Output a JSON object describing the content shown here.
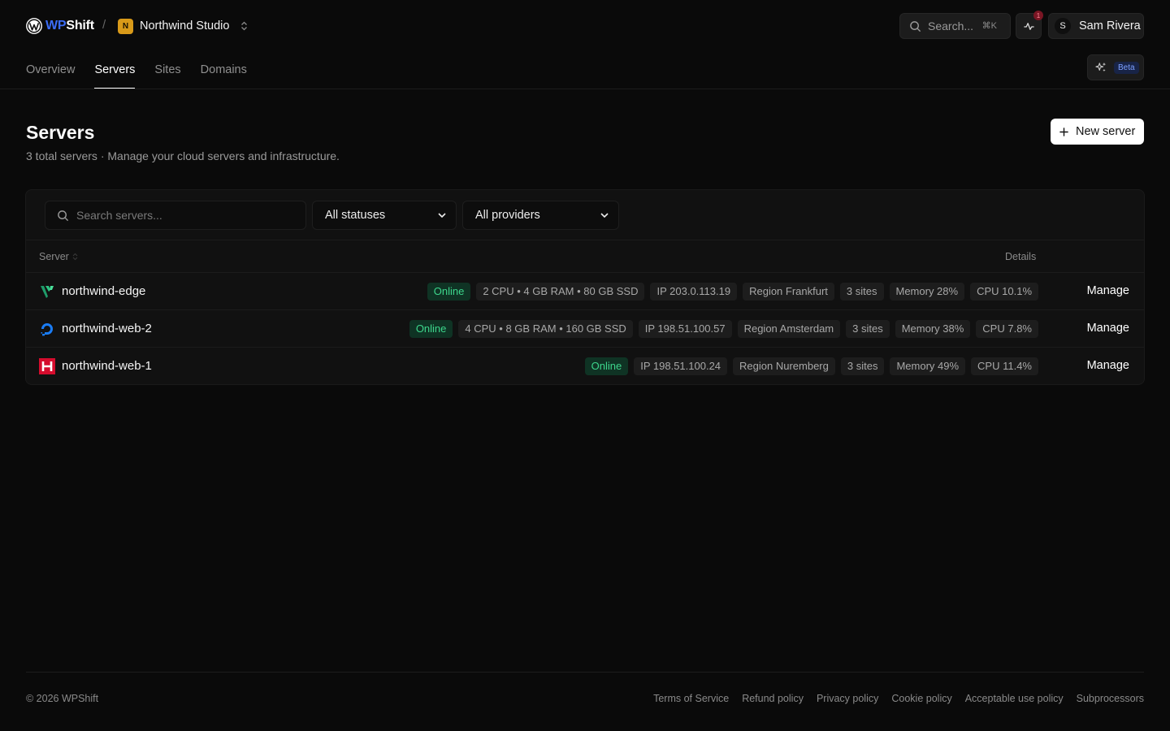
{
  "brand": {
    "name_part1": "WP",
    "name_part2": "Shift",
    "separator": "/"
  },
  "org": {
    "initial": "N",
    "name": "Northwind Studio",
    "color": "#d99a19"
  },
  "topbar": {
    "search_label": "Search...",
    "search_shortcut": "⌘K",
    "notification_count": "1",
    "user_initial": "S",
    "user_name": "Sam Rivera",
    "beta_label": "Beta"
  },
  "tabs": [
    {
      "label": "Overview",
      "active": false
    },
    {
      "label": "Servers",
      "active": true
    },
    {
      "label": "Sites",
      "active": false
    },
    {
      "label": "Domains",
      "active": false
    }
  ],
  "page": {
    "title": "Servers",
    "subtitle": "3 total servers · Manage your cloud servers and infrastructure.",
    "new_button": "New server"
  },
  "filters": {
    "search_placeholder": "Search servers...",
    "status_selected": "All statuses",
    "provider_selected": "All providers"
  },
  "table": {
    "col_server": "Server",
    "col_details": "Details",
    "manage_label": "Manage",
    "rows": [
      {
        "name": "northwind-edge",
        "provider_icon": "vultr-icon",
        "status": "Online",
        "specs": "2 CPU • 4 GB RAM • 80 GB SSD",
        "ip": "IP 203.0.113.19",
        "region": "Region Frankfurt",
        "sites": "3 sites",
        "memory": "Memory 28%",
        "cpu": "CPU 10.1%"
      },
      {
        "name": "northwind-web-2",
        "provider_icon": "digitalocean-icon",
        "status": "Online",
        "specs": "4 CPU • 8 GB RAM • 160 GB SSD",
        "ip": "IP 198.51.100.57",
        "region": "Region Amsterdam",
        "sites": "3 sites",
        "memory": "Memory 38%",
        "cpu": "CPU 7.8%"
      },
      {
        "name": "northwind-web-1",
        "provider_icon": "hetzner-icon",
        "status": "Online",
        "ip": "IP 198.51.100.24",
        "region": "Region Nuremberg",
        "sites": "3 sites",
        "memory": "Memory 49%",
        "cpu": "CPU 11.4%"
      }
    ]
  },
  "footer": {
    "copyright": "© 2026 WPShift",
    "links": [
      "Terms of Service",
      "Refund policy",
      "Privacy policy",
      "Cookie policy",
      "Acceptable use policy",
      "Subprocessors"
    ]
  },
  "colors": {
    "background": "#0a0a0a",
    "accent": "#3b6cf6",
    "online_text": "#3dd68c",
    "online_bg": "#0f3324"
  }
}
